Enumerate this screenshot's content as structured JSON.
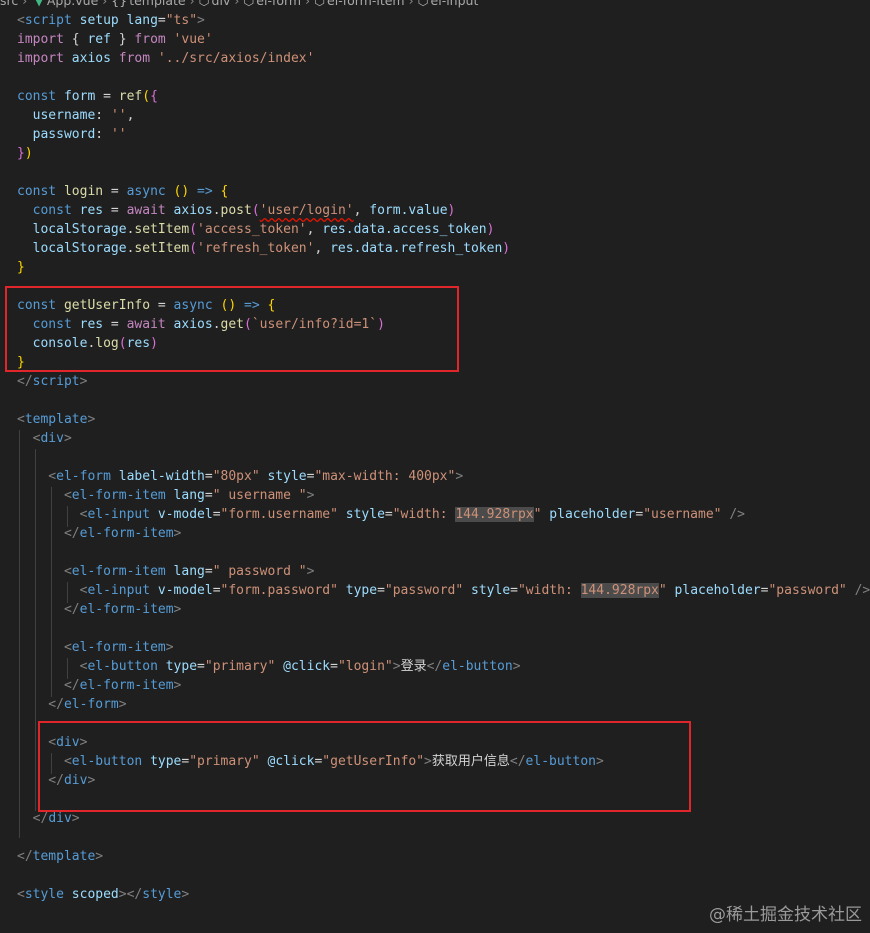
{
  "breadcrumb": {
    "items": [
      "src",
      "App.vue",
      "template",
      "div",
      "el-form",
      "el-form-item",
      "el-input"
    ],
    "glyphs": [
      "{}",
      "",
      "",
      ""
    ]
  },
  "code": {
    "l1": {
      "a": "<",
      "b": "script",
      "c": " setup",
      "d": " lang",
      "e": "=",
      "f": "\"ts\"",
      "g": ">"
    },
    "l2": {
      "a": "import",
      "b": " { ",
      "c": "ref",
      "d": " } ",
      "e": "from",
      "f": " 'vue'"
    },
    "l3": {
      "a": "import",
      "b": " axios ",
      "c": "from",
      "d": " '../src/axios/index'"
    },
    "l5": {
      "a": "const",
      "b": " form",
      "c": " = ",
      "d": "ref",
      "e": "(",
      "f": "{"
    },
    "l6": {
      "a": "  username",
      "b": ": ",
      "c": "''",
      "d": ","
    },
    "l7": {
      "a": "  password",
      "b": ": ",
      "c": "''"
    },
    "l8": {
      "a": "}",
      "b": ")"
    },
    "l10": {
      "a": "const",
      "b": " login",
      "c": " = ",
      "d": "async",
      "e": " () ",
      "f": "=>",
      "g": " {"
    },
    "l11": {
      "a": "  const",
      "b": " res",
      "c": " = ",
      "d": "await",
      "e": " axios",
      "f": ".",
      "g": "post",
      "h": "(",
      "i": "'user/login'",
      "j": ", ",
      "k": "form",
      "l": ".value",
      "m": ")"
    },
    "l12": {
      "a": "  localStorage",
      "b": ".",
      "c": "setItem",
      "d": "(",
      "e": "'access_token'",
      "f": ", ",
      "g": "res",
      "h": ".data.access_token",
      "i": ")"
    },
    "l13": {
      "a": "  localStorage",
      "b": ".",
      "c": "setItem",
      "d": "(",
      "e": "'refresh_token'",
      "f": ", ",
      "g": "res",
      "h": ".data.refresh_token",
      "i": ")"
    },
    "l14": {
      "a": "}"
    },
    "l16": {
      "a": "const",
      "b": " getUserInfo",
      "c": " = ",
      "d": "async",
      "e": " () ",
      "f": "=>",
      "g": " {"
    },
    "l17": {
      "a": "  const",
      "b": " res",
      "c": " = ",
      "d": "await",
      "e": " axios",
      "f": ".",
      "g": "get",
      "h": "(",
      "i": "`user/info?id=1`",
      "j": ")"
    },
    "l18": {
      "a": "  console",
      "b": ".",
      "c": "log",
      "d": "(",
      "e": "res",
      "f": ")"
    },
    "l19": {
      "a": "}"
    },
    "l20": {
      "a": "</",
      "b": "script",
      "c": ">"
    },
    "l22": {
      "a": "<",
      "b": "template",
      "c": ">"
    },
    "l23": {
      "a": "  <",
      "b": "div",
      "c": ">"
    },
    "l25": {
      "a": "    <",
      "b": "el-form",
      "c": " label-width",
      "d": "=",
      "e": "\"80px\"",
      "f": " style",
      "g": "=",
      "h": "\"max-width: 400px\"",
      "i": ">"
    },
    "l26": {
      "a": "      <",
      "b": "el-form-item",
      "c": " lang",
      "d": "=",
      "e": "\" username \"",
      "f": ">"
    },
    "l27": {
      "a": "        <",
      "b": "el-input",
      "c": " v-model",
      "d": "=",
      "e": "\"form.username\"",
      "f": " style",
      "g": "=",
      "h": "\"width: ",
      "i": "144.928rpx",
      "j": "\"",
      "k": " placeholder",
      "l": "=",
      "m": "\"username\"",
      "n": " />"
    },
    "l28": {
      "a": "      </",
      "b": "el-form-item",
      "c": ">"
    },
    "l30": {
      "a": "      <",
      "b": "el-form-item",
      "c": " lang",
      "d": "=",
      "e": "\" password \"",
      "f": ">"
    },
    "l31": {
      "a": "        <",
      "b": "el-input",
      "c": " v-model",
      "d": "=",
      "e": "\"form.password\"",
      "f": " type",
      "g": "=",
      "h": "\"password\"",
      "i": " style",
      "j": "=",
      "k": "\"width: ",
      "l": "144.928rpx",
      "m": "\"",
      "n": " placeholder",
      "o": "=",
      "p": "\"password\"",
      "q": " />"
    },
    "l32": {
      "a": "      </",
      "b": "el-form-item",
      "c": ">"
    },
    "l34": {
      "a": "      <",
      "b": "el-form-item",
      "c": ">"
    },
    "l35": {
      "a": "        <",
      "b": "el-button",
      "c": " type",
      "d": "=",
      "e": "\"primary\"",
      "f": " @click",
      "g": "=",
      "h": "\"login\"",
      "i": ">",
      "j": "登录",
      "k": "</",
      "l": "el-button",
      "m": ">"
    },
    "l36": {
      "a": "      </",
      "b": "el-form-item",
      "c": ">"
    },
    "l37": {
      "a": "    </",
      "b": "el-form",
      "c": ">"
    },
    "l39": {
      "a": "    <",
      "b": "div",
      "c": ">"
    },
    "l40": {
      "a": "      <",
      "b": "el-button",
      "c": " type",
      "d": "=",
      "e": "\"primary\"",
      "f": " @click",
      "g": "=",
      "h": "\"getUserInfo\"",
      "i": ">",
      "j": "获取用户信息",
      "k": "</",
      "l": "el-button",
      "m": ">"
    },
    "l41": {
      "a": "    </",
      "b": "div",
      "c": ">"
    },
    "l43": {
      "a": "  </",
      "b": "div",
      "c": ">"
    },
    "l45": {
      "a": "</",
      "b": "template",
      "c": ">"
    },
    "l47": {
      "a": "<",
      "b": "style",
      "c": " scoped",
      "d": "></",
      "e": "style",
      "f": ">"
    }
  },
  "watermark": "@稀土掘金技术社区",
  "colors": {
    "highlight_box": "#e0262b",
    "background": "#1f1f1f"
  }
}
